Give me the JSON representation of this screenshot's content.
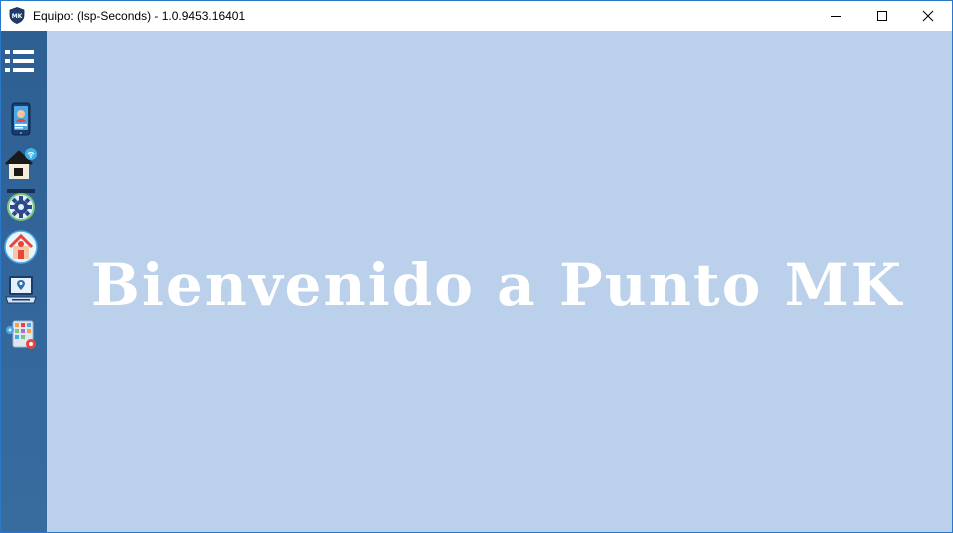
{
  "window": {
    "title": "Equipo: (lsp-Seconds) - 1.0.9453.16401",
    "app_icon": "mk-shield-icon",
    "controls": [
      "minimize-icon",
      "maximize-icon",
      "close-icon"
    ]
  },
  "sidebar": {
    "menu_icon": "list-menu-icon",
    "items": [
      {
        "icon": "phone-contact-icon"
      },
      {
        "icon": "smart-home-icon"
      },
      {
        "icon": "settings-gear-icon"
      },
      {
        "icon": "home-location-icon"
      },
      {
        "icon": "laptop-map-icon"
      },
      {
        "icon": "apps-settings-icon"
      }
    ]
  },
  "main": {
    "welcome_text": "Bienvenido a Punto MK"
  },
  "colors": {
    "sidebar": "#33669b",
    "content_bg": "#bbd0ea",
    "welcome_text": "#ffffff",
    "window_border": "#2b78c8"
  }
}
